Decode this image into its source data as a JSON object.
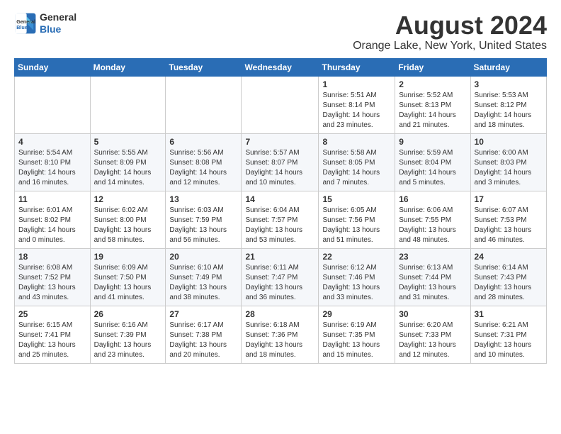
{
  "header": {
    "logo_line1": "General",
    "logo_line2": "Blue",
    "month_title": "August 2024",
    "location": "Orange Lake, New York, United States"
  },
  "weekdays": [
    "Sunday",
    "Monday",
    "Tuesday",
    "Wednesday",
    "Thursday",
    "Friday",
    "Saturday"
  ],
  "weeks": [
    [
      {
        "day": "",
        "info": ""
      },
      {
        "day": "",
        "info": ""
      },
      {
        "day": "",
        "info": ""
      },
      {
        "day": "",
        "info": ""
      },
      {
        "day": "1",
        "info": "Sunrise: 5:51 AM\nSunset: 8:14 PM\nDaylight: 14 hours\nand 23 minutes."
      },
      {
        "day": "2",
        "info": "Sunrise: 5:52 AM\nSunset: 8:13 PM\nDaylight: 14 hours\nand 21 minutes."
      },
      {
        "day": "3",
        "info": "Sunrise: 5:53 AM\nSunset: 8:12 PM\nDaylight: 14 hours\nand 18 minutes."
      }
    ],
    [
      {
        "day": "4",
        "info": "Sunrise: 5:54 AM\nSunset: 8:10 PM\nDaylight: 14 hours\nand 16 minutes."
      },
      {
        "day": "5",
        "info": "Sunrise: 5:55 AM\nSunset: 8:09 PM\nDaylight: 14 hours\nand 14 minutes."
      },
      {
        "day": "6",
        "info": "Sunrise: 5:56 AM\nSunset: 8:08 PM\nDaylight: 14 hours\nand 12 minutes."
      },
      {
        "day": "7",
        "info": "Sunrise: 5:57 AM\nSunset: 8:07 PM\nDaylight: 14 hours\nand 10 minutes."
      },
      {
        "day": "8",
        "info": "Sunrise: 5:58 AM\nSunset: 8:05 PM\nDaylight: 14 hours\nand 7 minutes."
      },
      {
        "day": "9",
        "info": "Sunrise: 5:59 AM\nSunset: 8:04 PM\nDaylight: 14 hours\nand 5 minutes."
      },
      {
        "day": "10",
        "info": "Sunrise: 6:00 AM\nSunset: 8:03 PM\nDaylight: 14 hours\nand 3 minutes."
      }
    ],
    [
      {
        "day": "11",
        "info": "Sunrise: 6:01 AM\nSunset: 8:02 PM\nDaylight: 14 hours\nand 0 minutes."
      },
      {
        "day": "12",
        "info": "Sunrise: 6:02 AM\nSunset: 8:00 PM\nDaylight: 13 hours\nand 58 minutes."
      },
      {
        "day": "13",
        "info": "Sunrise: 6:03 AM\nSunset: 7:59 PM\nDaylight: 13 hours\nand 56 minutes."
      },
      {
        "day": "14",
        "info": "Sunrise: 6:04 AM\nSunset: 7:57 PM\nDaylight: 13 hours\nand 53 minutes."
      },
      {
        "day": "15",
        "info": "Sunrise: 6:05 AM\nSunset: 7:56 PM\nDaylight: 13 hours\nand 51 minutes."
      },
      {
        "day": "16",
        "info": "Sunrise: 6:06 AM\nSunset: 7:55 PM\nDaylight: 13 hours\nand 48 minutes."
      },
      {
        "day": "17",
        "info": "Sunrise: 6:07 AM\nSunset: 7:53 PM\nDaylight: 13 hours\nand 46 minutes."
      }
    ],
    [
      {
        "day": "18",
        "info": "Sunrise: 6:08 AM\nSunset: 7:52 PM\nDaylight: 13 hours\nand 43 minutes."
      },
      {
        "day": "19",
        "info": "Sunrise: 6:09 AM\nSunset: 7:50 PM\nDaylight: 13 hours\nand 41 minutes."
      },
      {
        "day": "20",
        "info": "Sunrise: 6:10 AM\nSunset: 7:49 PM\nDaylight: 13 hours\nand 38 minutes."
      },
      {
        "day": "21",
        "info": "Sunrise: 6:11 AM\nSunset: 7:47 PM\nDaylight: 13 hours\nand 36 minutes."
      },
      {
        "day": "22",
        "info": "Sunrise: 6:12 AM\nSunset: 7:46 PM\nDaylight: 13 hours\nand 33 minutes."
      },
      {
        "day": "23",
        "info": "Sunrise: 6:13 AM\nSunset: 7:44 PM\nDaylight: 13 hours\nand 31 minutes."
      },
      {
        "day": "24",
        "info": "Sunrise: 6:14 AM\nSunset: 7:43 PM\nDaylight: 13 hours\nand 28 minutes."
      }
    ],
    [
      {
        "day": "25",
        "info": "Sunrise: 6:15 AM\nSunset: 7:41 PM\nDaylight: 13 hours\nand 25 minutes."
      },
      {
        "day": "26",
        "info": "Sunrise: 6:16 AM\nSunset: 7:39 PM\nDaylight: 13 hours\nand 23 minutes."
      },
      {
        "day": "27",
        "info": "Sunrise: 6:17 AM\nSunset: 7:38 PM\nDaylight: 13 hours\nand 20 minutes."
      },
      {
        "day": "28",
        "info": "Sunrise: 6:18 AM\nSunset: 7:36 PM\nDaylight: 13 hours\nand 18 minutes."
      },
      {
        "day": "29",
        "info": "Sunrise: 6:19 AM\nSunset: 7:35 PM\nDaylight: 13 hours\nand 15 minutes."
      },
      {
        "day": "30",
        "info": "Sunrise: 6:20 AM\nSunset: 7:33 PM\nDaylight: 13 hours\nand 12 minutes."
      },
      {
        "day": "31",
        "info": "Sunrise: 6:21 AM\nSunset: 7:31 PM\nDaylight: 13 hours\nand 10 minutes."
      }
    ]
  ]
}
